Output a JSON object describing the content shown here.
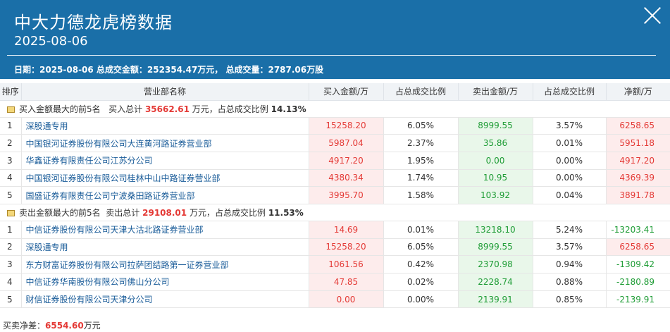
{
  "header": {
    "title": "中大力德龙虎榜数据",
    "date": "2025-08-06",
    "summary": "日期：2025-08-06 总成交金额：252354.47万元， 总成交量：2787.06万股"
  },
  "table": {
    "columns": [
      "排序",
      "营业部名称",
      "买入金额/万",
      "占总成交比例",
      "卖出金额/万",
      "占总成交比例",
      "净额/万"
    ]
  },
  "buy_section": {
    "label": "买入金额最大的前5名",
    "total_prefix": "买入总计",
    "total_value": "35662.61",
    "total_suffix": "万元，占总成交比例",
    "ratio": "14.13%",
    "rows": [
      {
        "rank": "1",
        "name": "深股通专用",
        "buy": "15258.20",
        "buy_pct": "6.05%",
        "sell": "8999.55",
        "sell_pct": "3.57%",
        "net": "6258.65"
      },
      {
        "rank": "2",
        "name": "中国银河证券股份有限公司大连黄河路证券营业部",
        "buy": "5987.04",
        "buy_pct": "2.37%",
        "sell": "35.86",
        "sell_pct": "0.01%",
        "net": "5951.18"
      },
      {
        "rank": "3",
        "name": "华鑫证券有限责任公司江苏分公司",
        "buy": "4917.20",
        "buy_pct": "1.95%",
        "sell": "0.00",
        "sell_pct": "0.00%",
        "net": "4917.20"
      },
      {
        "rank": "4",
        "name": "中国银河证券股份有限公司桂林中山中路证券营业部",
        "buy": "4380.34",
        "buy_pct": "1.74%",
        "sell": "10.95",
        "sell_pct": "0.00%",
        "net": "4369.39"
      },
      {
        "rank": "5",
        "name": "国盛证券有限责任公司宁波桑田路证券营业部",
        "buy": "3995.70",
        "buy_pct": "1.58%",
        "sell": "103.92",
        "sell_pct": "0.04%",
        "net": "3891.78"
      }
    ]
  },
  "sell_section": {
    "label": "卖出金额最大的前5名",
    "total_prefix": "卖出总计",
    "total_value": "29108.01",
    "total_suffix": "万元，占总成交比例",
    "ratio": "11.53%",
    "rows": [
      {
        "rank": "1",
        "name": "中信证券股份有限公司天津大沽北路证券营业部",
        "buy": "14.69",
        "buy_pct": "0.01%",
        "sell": "13218.10",
        "sell_pct": "5.24%",
        "net": "-13203.41"
      },
      {
        "rank": "2",
        "name": "深股通专用",
        "buy": "15258.20",
        "buy_pct": "6.05%",
        "sell": "8999.55",
        "sell_pct": "3.57%",
        "net": "6258.65"
      },
      {
        "rank": "3",
        "name": "东方财富证券股份有限公司拉萨团结路第一证券营业部",
        "buy": "1061.56",
        "buy_pct": "0.42%",
        "sell": "2370.98",
        "sell_pct": "0.94%",
        "net": "-1309.42"
      },
      {
        "rank": "4",
        "name": "中信证券华南股份有限公司佛山分公司",
        "buy": "47.85",
        "buy_pct": "0.02%",
        "sell": "2228.74",
        "sell_pct": "0.88%",
        "net": "-2180.89"
      },
      {
        "rank": "5",
        "name": "财信证券股份有限公司天津分公司",
        "buy": "0.00",
        "buy_pct": "0.00%",
        "sell": "2139.91",
        "sell_pct": "0.85%",
        "net": "-2139.91"
      }
    ]
  },
  "footer": {
    "label": "买卖净差：",
    "value": "6554.60",
    "unit": "万元"
  },
  "colors": {
    "header_bg": "#1a6fa8",
    "buy_red": "#e43a36",
    "sell_green": "#1e9c35"
  },
  "icons": {
    "close": "close-icon",
    "section": "folder-icon"
  }
}
